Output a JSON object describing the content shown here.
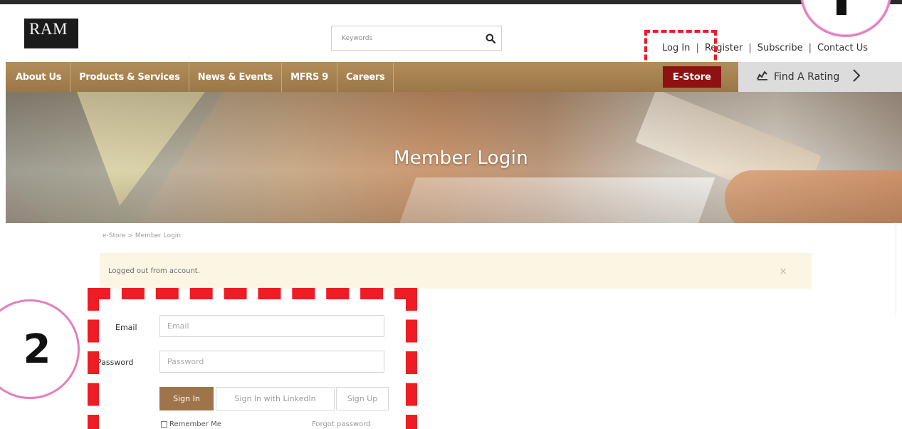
{
  "header": {
    "logo_text": "RAM",
    "search_placeholder": "Keywords",
    "top_links": [
      "Log In",
      "Register",
      "Subscribe",
      "Contact Us"
    ]
  },
  "nav": {
    "items": [
      "About Us",
      "Products & Services",
      "News & Events",
      "MFRS 9",
      "Careers"
    ],
    "estore": "E-Store",
    "find_rating": "Find A Rating"
  },
  "hero": {
    "title": "Member Login"
  },
  "breadcrumb": "e-Store > Member Login",
  "alert": {
    "message": "Logged out from account.",
    "close": "×"
  },
  "form": {
    "email_label": "Email",
    "email_placeholder": "Email",
    "password_label": "Password",
    "password_placeholder": "Password",
    "sign_in": "Sign In",
    "sign_in_linkedin": "Sign In with LinkedIn",
    "sign_up": "Sign Up",
    "remember_me": "Remember Me",
    "forgot_password": "Forgot password"
  },
  "annotations": {
    "step_2": "2"
  },
  "colors": {
    "nav_brown": "#a8834f",
    "estore_red": "#8f1212",
    "sign_in_brown": "#a0744a",
    "highlight_red": "#ee1c25",
    "circle_pink": "#e27fc2"
  },
  "icons": [
    "search-icon",
    "rating-icon",
    "chevron-right-icon",
    "close-icon"
  ]
}
